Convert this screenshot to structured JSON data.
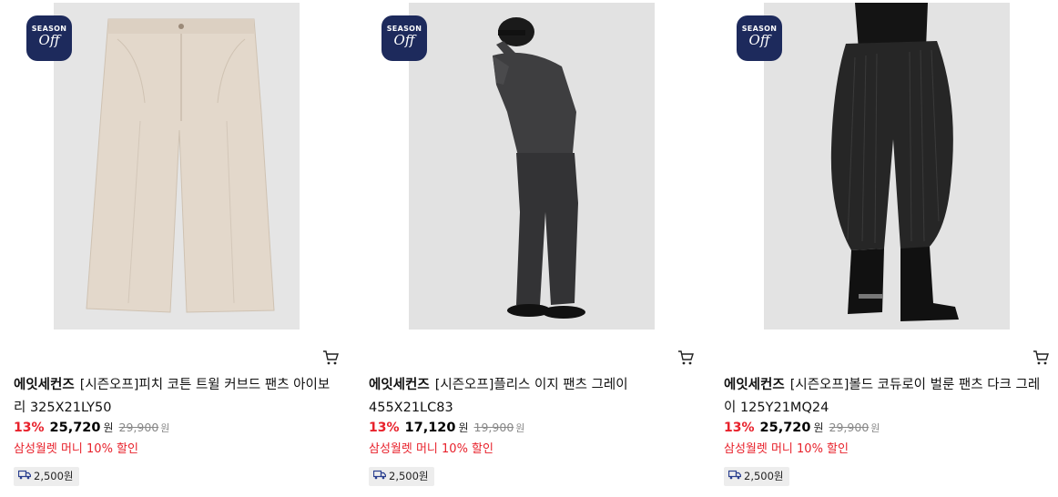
{
  "badge": {
    "line1": "SEASON",
    "line2": "Off"
  },
  "shipping": {
    "fee": "2,500원",
    "icon": "delivery-truck-icon"
  },
  "cart_icon": "cart-icon",
  "colors": {
    "discount": "#e8212b",
    "badge_bg": "#1d2a5c"
  },
  "products": [
    {
      "brand": "에잇세컨즈",
      "name": "[시즌오프]피치 코튼 트윌 커브드 팬츠 아이보리 325X21LY50",
      "discount": "13%",
      "price": "25,720",
      "price_unit": "원",
      "original_price": "29,900",
      "original_unit": "원",
      "promo": "삼성월렛 머니 10% 할인",
      "shipping": "2,500원"
    },
    {
      "brand": "에잇세컨즈",
      "name": "[시즌오프]플리스 이지 팬츠 그레이 455X21LC83",
      "discount": "13%",
      "price": "17,120",
      "price_unit": "원",
      "original_price": "19,900",
      "original_unit": "원",
      "promo": "삼성월렛 머니 10% 할인",
      "shipping": "2,500원"
    },
    {
      "brand": "에잇세컨즈",
      "name": "[시즌오프]볼드 코듀로이 벌룬 팬츠 다크 그레이 125Y21MQ24",
      "discount": "13%",
      "price": "25,720",
      "price_unit": "원",
      "original_price": "29,900",
      "original_unit": "원",
      "promo": "삼성월렛 머니 10% 할인",
      "shipping": "2,500원"
    }
  ]
}
